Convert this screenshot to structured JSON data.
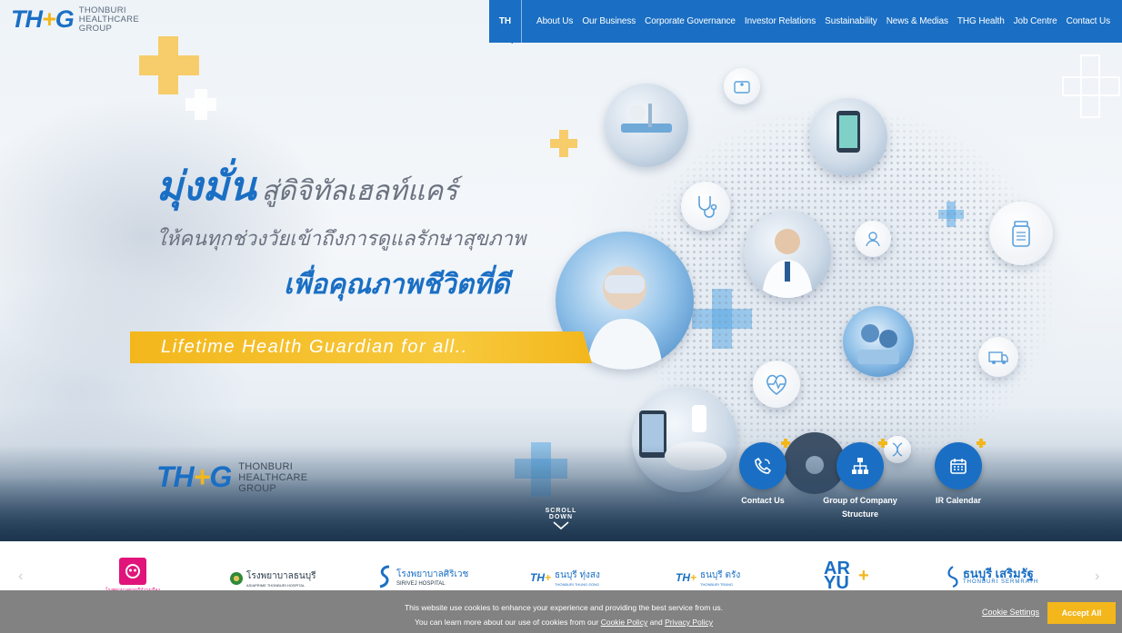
{
  "header": {
    "logo_mark": "TH",
    "logo_mark_plus": "+",
    "logo_mark_end": "G",
    "logo_lines": [
      "THONBURI",
      "HEALTHCARE",
      "GROUP"
    ],
    "lang": "TH",
    "nav": [
      "About Us",
      "Our Business",
      "Corporate Governance",
      "Investor Relations",
      "Sustainability",
      "News & Medias",
      "THG Health",
      "Job Centre",
      "Contact Us"
    ]
  },
  "hero": {
    "headline_bold": "มุ่งมั่น",
    "headline_light": "สู่ดิจิทัลเฮลท์แคร์",
    "line2": "ให้คนทุกช่วงวัยเข้าถึงการดูแลรักษาสุขภาพ",
    "line3": "เพื่อคุณภาพชีวิตที่ดี",
    "tagline": "Lifetime Health Guardian for all..",
    "scroll_down": "SCROLL DOWN",
    "quick_links": [
      {
        "label": "Contact Us",
        "icon": "phone-icon"
      },
      {
        "label": "Group of Company Structure",
        "icon": "org-chart-icon"
      },
      {
        "label": "IR Calendar",
        "icon": "calendar-icon"
      }
    ]
  },
  "partners": {
    "items": [
      {
        "name": "โรงพยาบาลธนบุรีบำรุงเมือง"
      },
      {
        "name": "โรงพยาบาลธนบุรี",
        "sub": "ASIAPRIME THONBURI HOSPITAL"
      },
      {
        "name": "โรงพยาบาลศิริเวช",
        "sub": "SIRIVEJ HOSPITAL"
      },
      {
        "name": "ธนบุรี ทุ่งสง",
        "sub": "THONBURI THUNG SONG"
      },
      {
        "name": "ธนบุรี ตรัง",
        "sub": "THONBURI TRANG"
      },
      {
        "name": "ARYU"
      },
      {
        "name": "ธนบุรี เสริมรัฐ",
        "sub": "THONBURI SERMRATH"
      }
    ]
  },
  "cookie": {
    "line1": "This website use cookies to enhance your experience and providing the best service from us.",
    "line2_prefix": "You can learn more about our use of cookies from our",
    "cookie_policy": "Cookie Policy",
    "and": "and",
    "privacy_policy": "Privacy Policy",
    "settings": "Cookie Settings",
    "accept": "Accept All"
  },
  "colors": {
    "brand_blue": "#1a6fc4",
    "brand_yellow": "#f3b71c",
    "cookie_bg": "#787878"
  }
}
